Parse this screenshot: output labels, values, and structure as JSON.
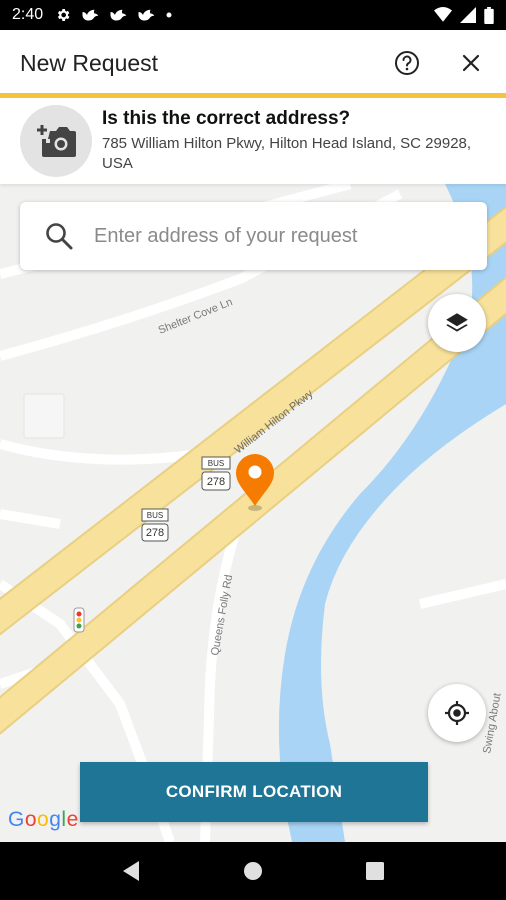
{
  "status_bar": {
    "time": "2:40",
    "left_icons": [
      "gear-icon",
      "bird-icon",
      "bird-icon",
      "bird-icon",
      "dot-icon"
    ],
    "right_icons": [
      "wifi-icon",
      "signal-icon",
      "battery-icon"
    ]
  },
  "app_bar": {
    "title": "New Request",
    "help_icon": "help-circle-icon",
    "close_icon": "close-icon"
  },
  "address_card": {
    "question": "Is this the correct address?",
    "address": "785 William Hilton Pkwy, Hilton Head Island, SC 29928, USA",
    "photo_icon": "add-photo-icon"
  },
  "search": {
    "placeholder": "Enter address of your request"
  },
  "map": {
    "labels": {
      "shelter_cove": "Shelter Cove Ln",
      "william_hilton": "William Hilton Pkwy",
      "queens_folly": "Queens Folly Rd",
      "swing_about": "Swing About",
      "shield_top": "BUS",
      "shield_num": "278"
    },
    "pin_color": "#f57c00",
    "road_color": "#f8e29b",
    "water_color": "#a9d4f5"
  },
  "buttons": {
    "layers_icon": "layers-icon",
    "my_location_icon": "my-location-icon",
    "confirm": "CONFIRM LOCATION"
  },
  "google": "Google",
  "colors": {
    "accent": "#f7c33d",
    "primary": "#1e7596"
  },
  "nav": [
    "back-icon",
    "home-icon",
    "recents-icon"
  ]
}
